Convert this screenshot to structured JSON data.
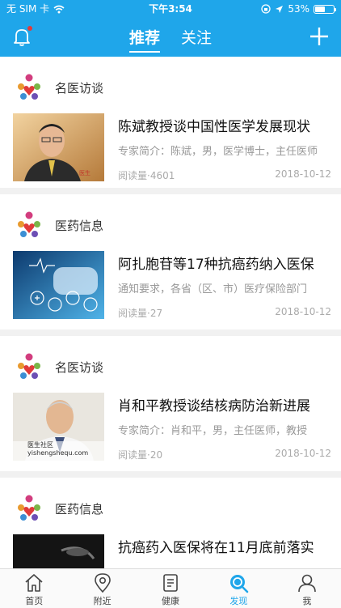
{
  "status_bar": {
    "carrier": "无 SIM 卡",
    "time": "下午3:54",
    "battery": "53%",
    "battery_level": 0.53
  },
  "header": {
    "tabs": [
      {
        "label": "推荐",
        "active": true
      },
      {
        "label": "关注",
        "active": false
      }
    ],
    "accent_color": "#1fa6ea"
  },
  "feed": [
    {
      "category": "名医访谈",
      "title": "陈斌教授谈中国性医学发展现状",
      "summary": "专家简介：陈斌，男，医学博士，主任医师",
      "reads": "阅读量·4601",
      "date": "2018-10-12"
    },
    {
      "category": "医药信息",
      "title": "阿扎胞苷等17种抗癌药纳入医保",
      "summary": "通知要求，各省（区、市）医疗保险部门",
      "reads": "阅读量·27",
      "date": "2018-10-12"
    },
    {
      "category": "名医访谈",
      "title": "肖和平教授谈结核病防治新进展",
      "summary": "专家简介：肖和平，男，主任医师，教授",
      "reads": "阅读量·20",
      "date": "2018-10-12"
    },
    {
      "category": "医药信息",
      "title": "抗癌药入医保将在11月底前落实",
      "summary": "",
      "reads": "",
      "date": ""
    }
  ],
  "watermark": "医生社区 yishengshequ.com",
  "tabbar": [
    {
      "label": "首页",
      "icon": "home-icon",
      "active": false
    },
    {
      "label": "附近",
      "icon": "location-pin-icon",
      "active": false
    },
    {
      "label": "健康",
      "icon": "document-icon",
      "active": false
    },
    {
      "label": "发现",
      "icon": "discover-search-icon",
      "active": true
    },
    {
      "label": "我",
      "icon": "user-icon",
      "active": false
    }
  ]
}
